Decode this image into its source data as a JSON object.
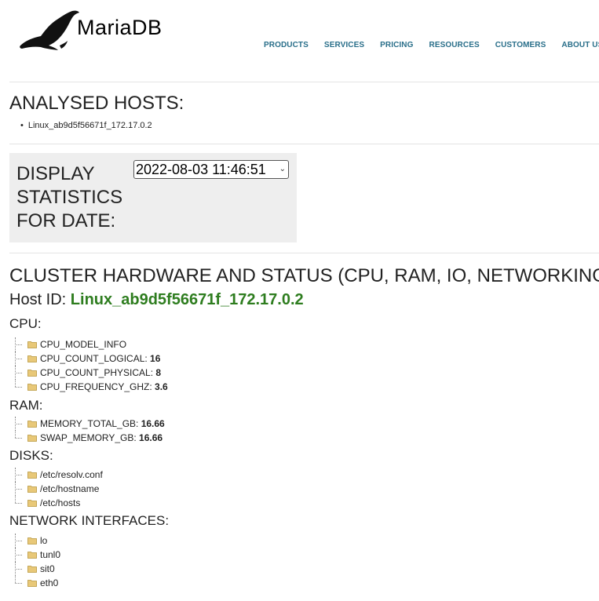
{
  "brand": {
    "name_part1": "Maria",
    "name_part2": "DB",
    "logo_icon": "seal-icon",
    "accent_color": "#2a6f8a"
  },
  "nav": {
    "items": [
      "PRODUCTS",
      "SERVICES",
      "PRICING",
      "RESOURCES",
      "CUSTOMERS",
      "ABOUT US"
    ]
  },
  "analysed": {
    "title": "ANALYSED HOSTS:",
    "hosts": [
      "Linux_ab9d5f56671f_172.17.0.2"
    ]
  },
  "date_filter": {
    "label": "DISPLAY STATISTICS FOR DATE:",
    "selected": "2022-08-03 11:46:51"
  },
  "cluster": {
    "title": "CLUSTER HARDWARE AND STATUS (CPU, RAM, IO, NETWORKING ):",
    "host_id_label": "Host ID: ",
    "host_id": "Linux_ab9d5f56671f_172.17.0.2",
    "host_id_color": "#2e7d1f"
  },
  "sections": {
    "cpu": {
      "title": "CPU:",
      "items": [
        {
          "key": "CPU_MODEL_INFO",
          "value": ""
        },
        {
          "key": "CPU_COUNT_LOGICAL: ",
          "value": "16"
        },
        {
          "key": "CPU_COUNT_PHYSICAL: ",
          "value": "8"
        },
        {
          "key": "CPU_FREQUENCY_GHZ: ",
          "value": "3.6"
        }
      ]
    },
    "ram": {
      "title": "RAM:",
      "items": [
        {
          "key": "MEMORY_TOTAL_GB: ",
          "value": "16.66"
        },
        {
          "key": "SWAP_MEMORY_GB: ",
          "value": "16.66"
        }
      ]
    },
    "disks": {
      "title": "DISKS:",
      "items": [
        {
          "key": "/etc/resolv.conf",
          "value": ""
        },
        {
          "key": "/etc/hostname",
          "value": ""
        },
        {
          "key": "/etc/hosts",
          "value": ""
        }
      ]
    },
    "network": {
      "title": "NETWORK INTERFACES:",
      "items": [
        {
          "key": "lo",
          "value": ""
        },
        {
          "key": "tunl0",
          "value": ""
        },
        {
          "key": "sit0",
          "value": ""
        },
        {
          "key": "eth0",
          "value": ""
        }
      ]
    }
  }
}
